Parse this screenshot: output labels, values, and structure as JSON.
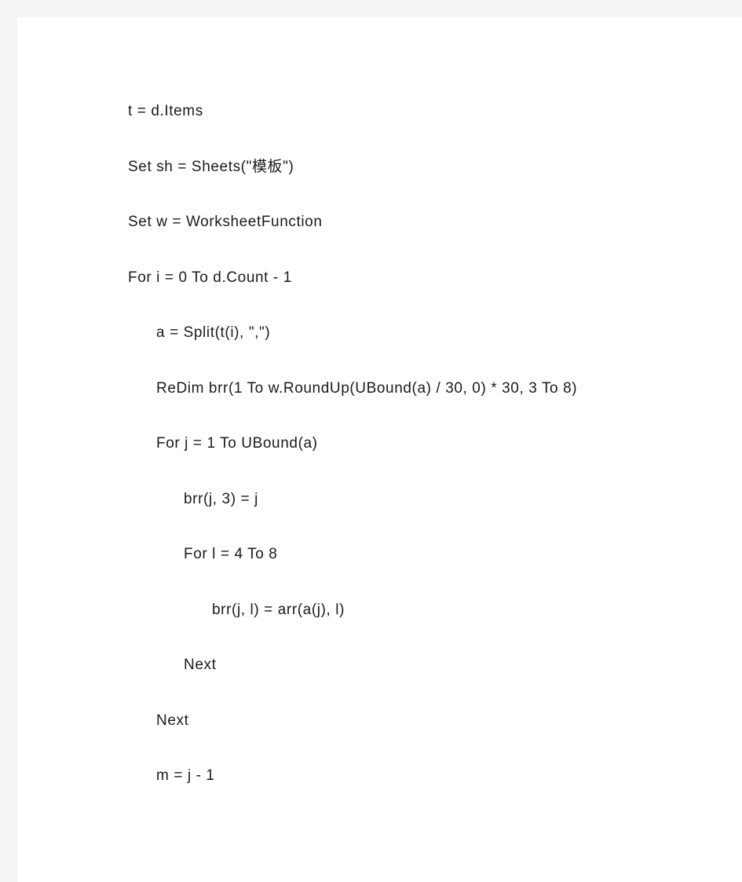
{
  "document": {
    "background_color": "#f4f4f4",
    "page_color": "#ffffff",
    "text_color": "#1a1a1a",
    "language": "VBA"
  },
  "code": {
    "lines": [
      {
        "text": "t = d.Items",
        "indent": 0
      },
      {
        "text": "Set sh = Sheets(\"模板\")",
        "indent": 0
      },
      {
        "text": "Set w = WorksheetFunction",
        "indent": 0
      },
      {
        "text": "For i = 0 To d.Count - 1",
        "indent": 0
      },
      {
        "text": "a = Split(t(i), \",\")",
        "indent": 1
      },
      {
        "text": "ReDim brr(1 To w.RoundUp(UBound(a) / 30, 0) * 30, 3 To 8)",
        "indent": 1
      },
      {
        "text": "For j = 1 To UBound(a)",
        "indent": 1
      },
      {
        "text": "brr(j, 3) = j",
        "indent": 2
      },
      {
        "text": "For l = 4 To 8",
        "indent": 2
      },
      {
        "text": "brr(j, l) = arr(a(j), l)",
        "indent": 3
      },
      {
        "text": "Next",
        "indent": 2
      },
      {
        "text": "Next",
        "indent": 1
      },
      {
        "text": "m = j - 1",
        "indent": 1
      }
    ]
  }
}
